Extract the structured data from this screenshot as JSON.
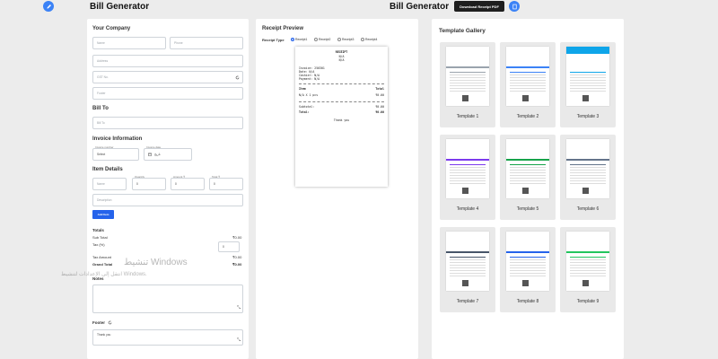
{
  "header": {
    "left_title": "Bill Generator",
    "right_title": "Bill Generator",
    "download_label": "Download Receipt PDF"
  },
  "form": {
    "your_company_title": "Your Company",
    "name_ph": "Name",
    "phone_ph": "Phone",
    "address_ph": "Address",
    "gst_ph": "GST No.",
    "footer_code_ph": "Footer",
    "bill_to_title": "Bill To",
    "bill_to_ph": "Bill To",
    "invoice_info_title": "Invoice Information",
    "invoice_number_label": "Invoice number",
    "invoice_number_value": "Select",
    "invoice_date_label": "Invoice date",
    "invoice_date_value": "تاريخ",
    "item_details_title": "Item Details",
    "item_name_ph": "Name",
    "qty_label": "Quantity",
    "qty_value": "0",
    "amount_label": "Amount ₹",
    "amount_value": "0",
    "total_label": "Total ₹",
    "total_value": "0",
    "description_ph": "Description",
    "add_item_label": "Add Item",
    "totals_title": "Totals",
    "subtotal_label": "Sub Total",
    "subtotal_value": "₹0.00",
    "tax_label": "Tax (%)",
    "tax_value": "0",
    "tax_amount_label": "Tax Amount",
    "tax_amount_value": "₹0.00",
    "grand_total_label": "Grand Total",
    "grand_total_value": "₹0.00",
    "notes_title": "Notes",
    "footer_title": "Footer",
    "footer_value": "Thank you"
  },
  "receipt": {
    "title": "Receipt Preview",
    "type_label": "Receipt Type",
    "types": [
      "Receipt1",
      "Receipt2",
      "Receipt3",
      "Receipt4"
    ],
    "selected_type": "Receipt1",
    "lines": [
      "RECEIPT",
      "N/A",
      "N/A",
      "Invoice: 250301",
      "Date: N/A",
      "Cashier: N/A",
      "Payment: N/A",
      "Item",
      "Total",
      "N/A X 1 pcs",
      "₹0.00",
      "Subtotal:",
      "₹0.00",
      "Total:",
      "₹0.00",
      "Thank you"
    ]
  },
  "gallery": {
    "title": "Template Gallery",
    "templates": [
      "Template 1",
      "Template 2",
      "Template 3",
      "Template 4",
      "Template 5",
      "Template 6",
      "Template 7",
      "Template 8",
      "Template 9"
    ],
    "accents": [
      "#9aa3ad",
      "#3b82f6",
      "#0ea5e9",
      "#7c3aed",
      "#16a34a",
      "#64748b",
      "#475569",
      "#2563eb",
      "#22c55e"
    ]
  },
  "watermark": {
    "line1": "تنشيط Windows",
    "line2": "انتقل إلى الإعدادات لتنشيط Windows."
  }
}
